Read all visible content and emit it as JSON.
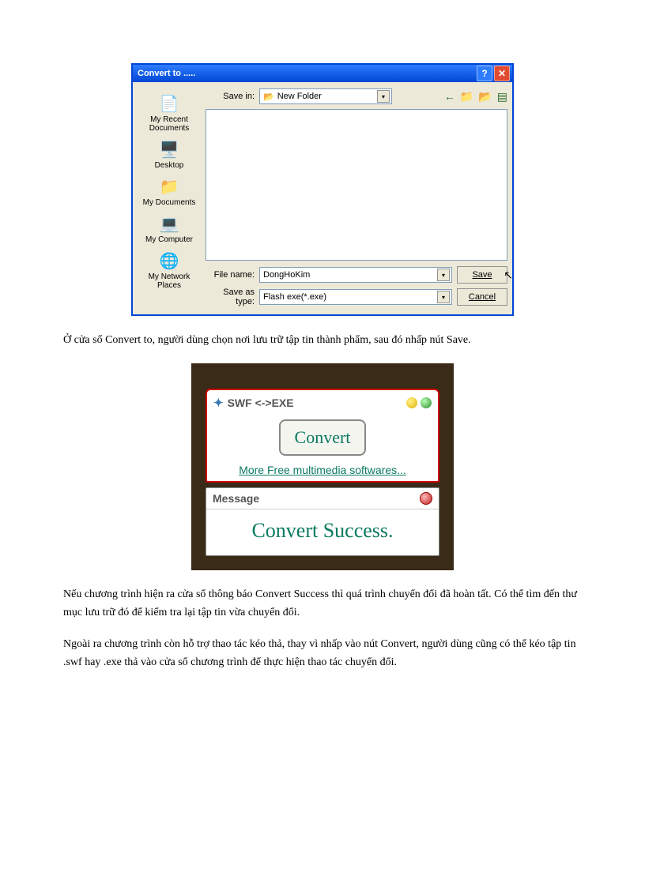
{
  "save_dialog": {
    "title": "Convert to .....",
    "save_in_label": "Save in:",
    "save_in_value": "New Folder",
    "places": [
      {
        "label": "My Recent Documents",
        "icon": "📄"
      },
      {
        "label": "Desktop",
        "icon": "🖥️"
      },
      {
        "label": "My Documents",
        "icon": "📁"
      },
      {
        "label": "My Computer",
        "icon": "💻"
      },
      {
        "label": "My Network Places",
        "icon": "🌐"
      }
    ],
    "file_name_label": "File name:",
    "file_name_value": "DongHoKim",
    "save_as_type_label": "Save as type:",
    "save_as_type_value": "Flash exe(*.exe)",
    "save_btn": "Save",
    "cancel_btn": "Cancel"
  },
  "para1": "Ở cửa sổ Convert to, người dùng chọn nơi lưu trữ tập tin thành phẩm, sau đó nhấp nút Save.",
  "swf_panel": {
    "title": "SWF <->EXE",
    "convert_btn": "Convert",
    "more_link": "More Free multimedia softwares..."
  },
  "message_panel": {
    "title": "Message",
    "body": "Convert Success."
  },
  "para2": "Nếu chương trình hiện ra cửa sổ thông báo Convert Success thì quá trình chuyển đổi đã hoàn tất. Có thể tìm đến thư mục lưu trữ đó để kiểm tra lại tập tin vừa chuyển đổi.",
  "para3": "Ngoài ra chương trình còn hỗ trợ thao tác kéo thả, thay vì nhấp vào nút Convert, người dùng cũng có thể kéo tập tin .swf hay .exe thả vào cửa sổ chương trình để thực hiện thao tác chuyển đổi."
}
